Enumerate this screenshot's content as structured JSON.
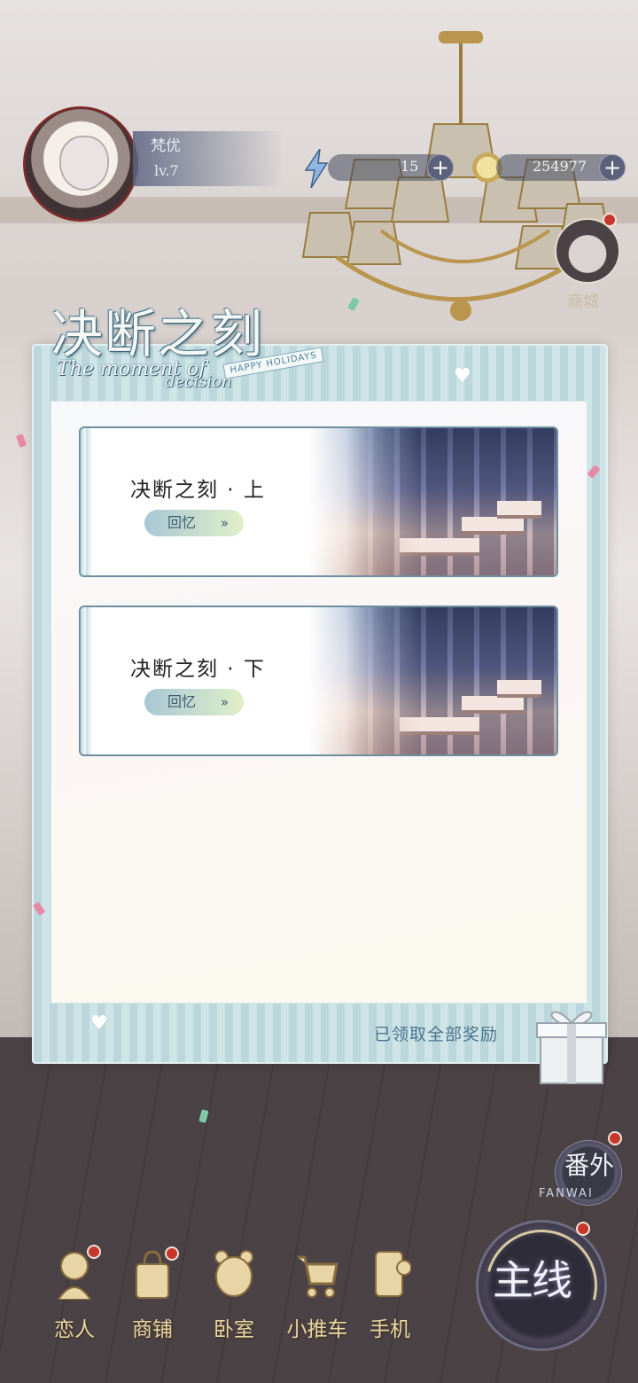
{
  "hud": {
    "player_name": "梵优",
    "player_level": "lv.7",
    "energy": "15",
    "gold": "254977",
    "side_shop_label": "商城"
  },
  "modal": {
    "title_cn": "决断之刻",
    "title_en_line1": "The moment of",
    "title_en_line2": "decision",
    "title_tag": "HAPPY HOLIDAYS",
    "chapters": [
      {
        "title": "决断之刻 · 上",
        "recall_label": "回忆",
        "chevron": "»"
      },
      {
        "title": "决断之刻 · 下",
        "recall_label": "回忆",
        "chevron": "»"
      }
    ],
    "claimed_status": "已领取全部奖励"
  },
  "side_buttons": {
    "fanwai_cn": "番外",
    "fanwai_en": "FANWAI",
    "main_story": "主线"
  },
  "nav": [
    {
      "label": "恋人",
      "icon": "lover-icon"
    },
    {
      "label": "商铺",
      "icon": "shop-bag-icon"
    },
    {
      "label": "卧室",
      "icon": "bedroom-bear-icon"
    },
    {
      "label": "小推车",
      "icon": "cart-icon"
    },
    {
      "label": "手机",
      "icon": "phone-icon"
    }
  ],
  "colors": {
    "accent_teal": "#4c7690",
    "nav_gold": "#e9d6a4",
    "notification_red": "#c7362c"
  }
}
